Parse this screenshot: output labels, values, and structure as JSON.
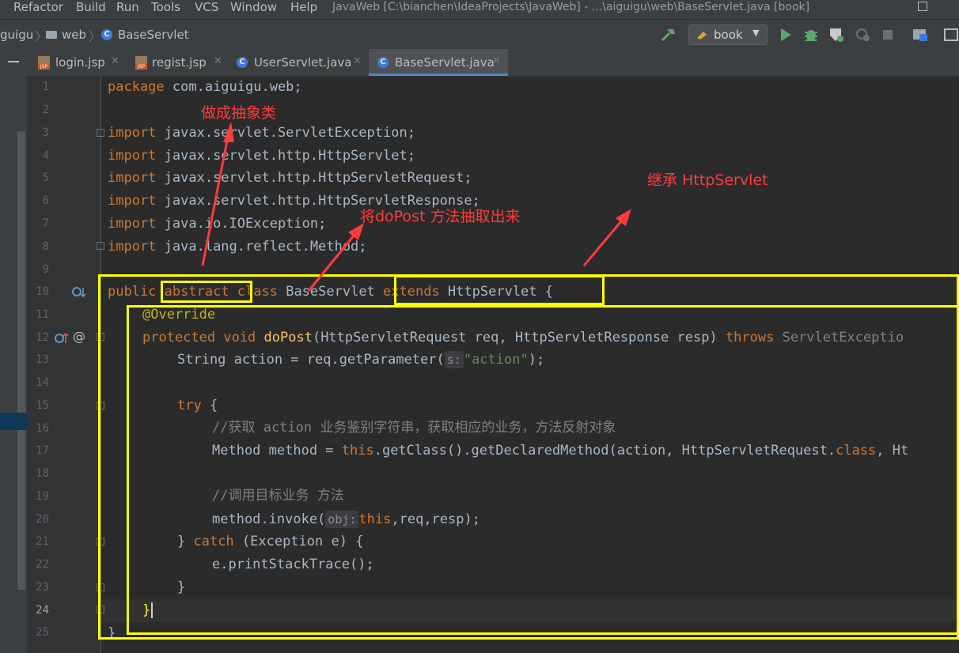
{
  "menu": [
    "Refactor",
    "Build",
    "Run",
    "Tools",
    "VCS",
    "Window",
    "Help"
  ],
  "window_title": "JavaWeb [C:\\bianchen\\IdeaProjects\\JavaWeb] - ...\\aiguigu\\web\\BaseServlet.java [book]",
  "breadcrumb": [
    "guigu",
    "web",
    "BaseServlet"
  ],
  "run_config": "book",
  "tabs": [
    {
      "label": "login.jsp",
      "icon": "jsp-file-icon"
    },
    {
      "label": "regist.jsp",
      "icon": "jsp-file-icon"
    },
    {
      "label": "UserServlet.java",
      "icon": "java-class-icon"
    },
    {
      "label": "BaseServlet.java",
      "icon": "java-class-icon",
      "active": true
    }
  ],
  "line_numbers": [
    "1",
    "2",
    "3",
    "4",
    "5",
    "6",
    "7",
    "8",
    "9",
    "10",
    "11",
    "12",
    "13",
    "14",
    "15",
    "16",
    "17",
    "18",
    "19",
    "20",
    "21",
    "22",
    "23",
    "24",
    "25"
  ],
  "current_line": "24",
  "code": {
    "l1_kw": "package",
    "l1_rest": " com.aiguigu.web;",
    "import_kw": "import",
    "l3": " javax.servlet.ServletException;",
    "l4": " javax.servlet.http.HttpServlet;",
    "l5": " javax.servlet.http.HttpServletRequest;",
    "l6": " javax.servlet.http.HttpServletResponse;",
    "l7": " java.io.IOException;",
    "l8": " java.lang.reflect.Method;",
    "l10_public": "public ",
    "l10_abstract": "abstract",
    "l10_class": " class",
    "l10_name": " BaseServlet ",
    "l10_extends": "extends",
    "l10_rest": " HttpServlet {",
    "l11": "@Override",
    "l12_kw": "protected void ",
    "l12_fn": "doPost",
    "l12_args": "(HttpServletRequest req, HttpServletResponse resp) ",
    "l12_throws": "throws ",
    "l12_exc": "ServletExceptio",
    "l13_a": "String action = req.getParameter(",
    "l13_hint": "s:",
    "l13_str": "\"action\"",
    "l13_b": ");",
    "l15_kw": "try",
    "l15_rest": " {",
    "l16": "//获取 action 业务鉴别字符串，获取相应的业务，方法反射对象",
    "l17_a": "Method method = ",
    "l17_this": "this",
    "l17_b": ".getClass().getDeclaredMethod(action, HttpServletRequest.",
    "l17_cls": "class",
    "l17_c": ", Ht",
    "l19": "//调用目标业务 方法",
    "l20_a": "method.invoke(",
    "l20_hint": "obj:",
    "l20_this": "this",
    "l20_b": ",req,resp);",
    "l21_a": "} ",
    "l21_kw": "catch",
    "l21_b": " (Exception e) {",
    "l22": "e.printStackTrace();",
    "l23": "}",
    "l24": "}",
    "l25": "}"
  },
  "annotations": {
    "abstract_note": "做成抽象类",
    "dopost_note": "将doPost 方法抽取出来",
    "extends_note": "继承 HttpServlet"
  }
}
